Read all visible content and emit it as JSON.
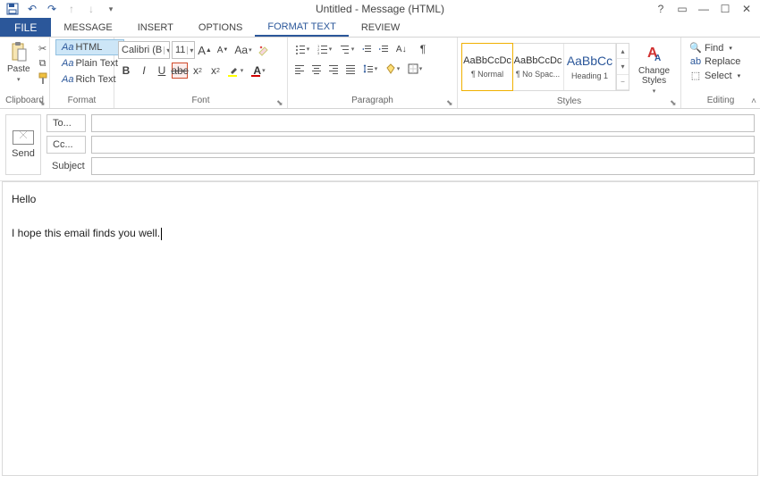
{
  "title": "Untitled - Message (HTML)",
  "tabs": {
    "file": "FILE",
    "items": [
      "MESSAGE",
      "INSERT",
      "OPTIONS",
      "FORMAT TEXT",
      "REVIEW"
    ],
    "active": 3
  },
  "ribbon": {
    "clipboard": {
      "label": "Clipboard",
      "paste": "Paste"
    },
    "format": {
      "label": "Format",
      "html": "Aa HTML",
      "plain": "Aa Plain Text",
      "rich": "Aa Rich Text"
    },
    "font": {
      "label": "Font",
      "name": "Calibri (B",
      "size": "11"
    },
    "paragraph": {
      "label": "Paragraph"
    },
    "styles": {
      "label": "Styles",
      "items": [
        {
          "preview": "AaBbCcDc",
          "name": "¶ Normal"
        },
        {
          "preview": "AaBbCcDc",
          "name": "¶ No Spac..."
        },
        {
          "preview": "AaBbCc",
          "name": "Heading 1"
        }
      ],
      "change": "Change Styles"
    },
    "editing": {
      "label": "Editing",
      "find": "Find",
      "replace": "Replace",
      "select": "Select"
    }
  },
  "header": {
    "send": "Send",
    "to": "To...",
    "cc": "Cc...",
    "subject": "Subject",
    "to_val": "",
    "cc_val": "",
    "subject_val": ""
  },
  "body": {
    "line1": "Hello",
    "line2": "I hope this email finds you well."
  }
}
